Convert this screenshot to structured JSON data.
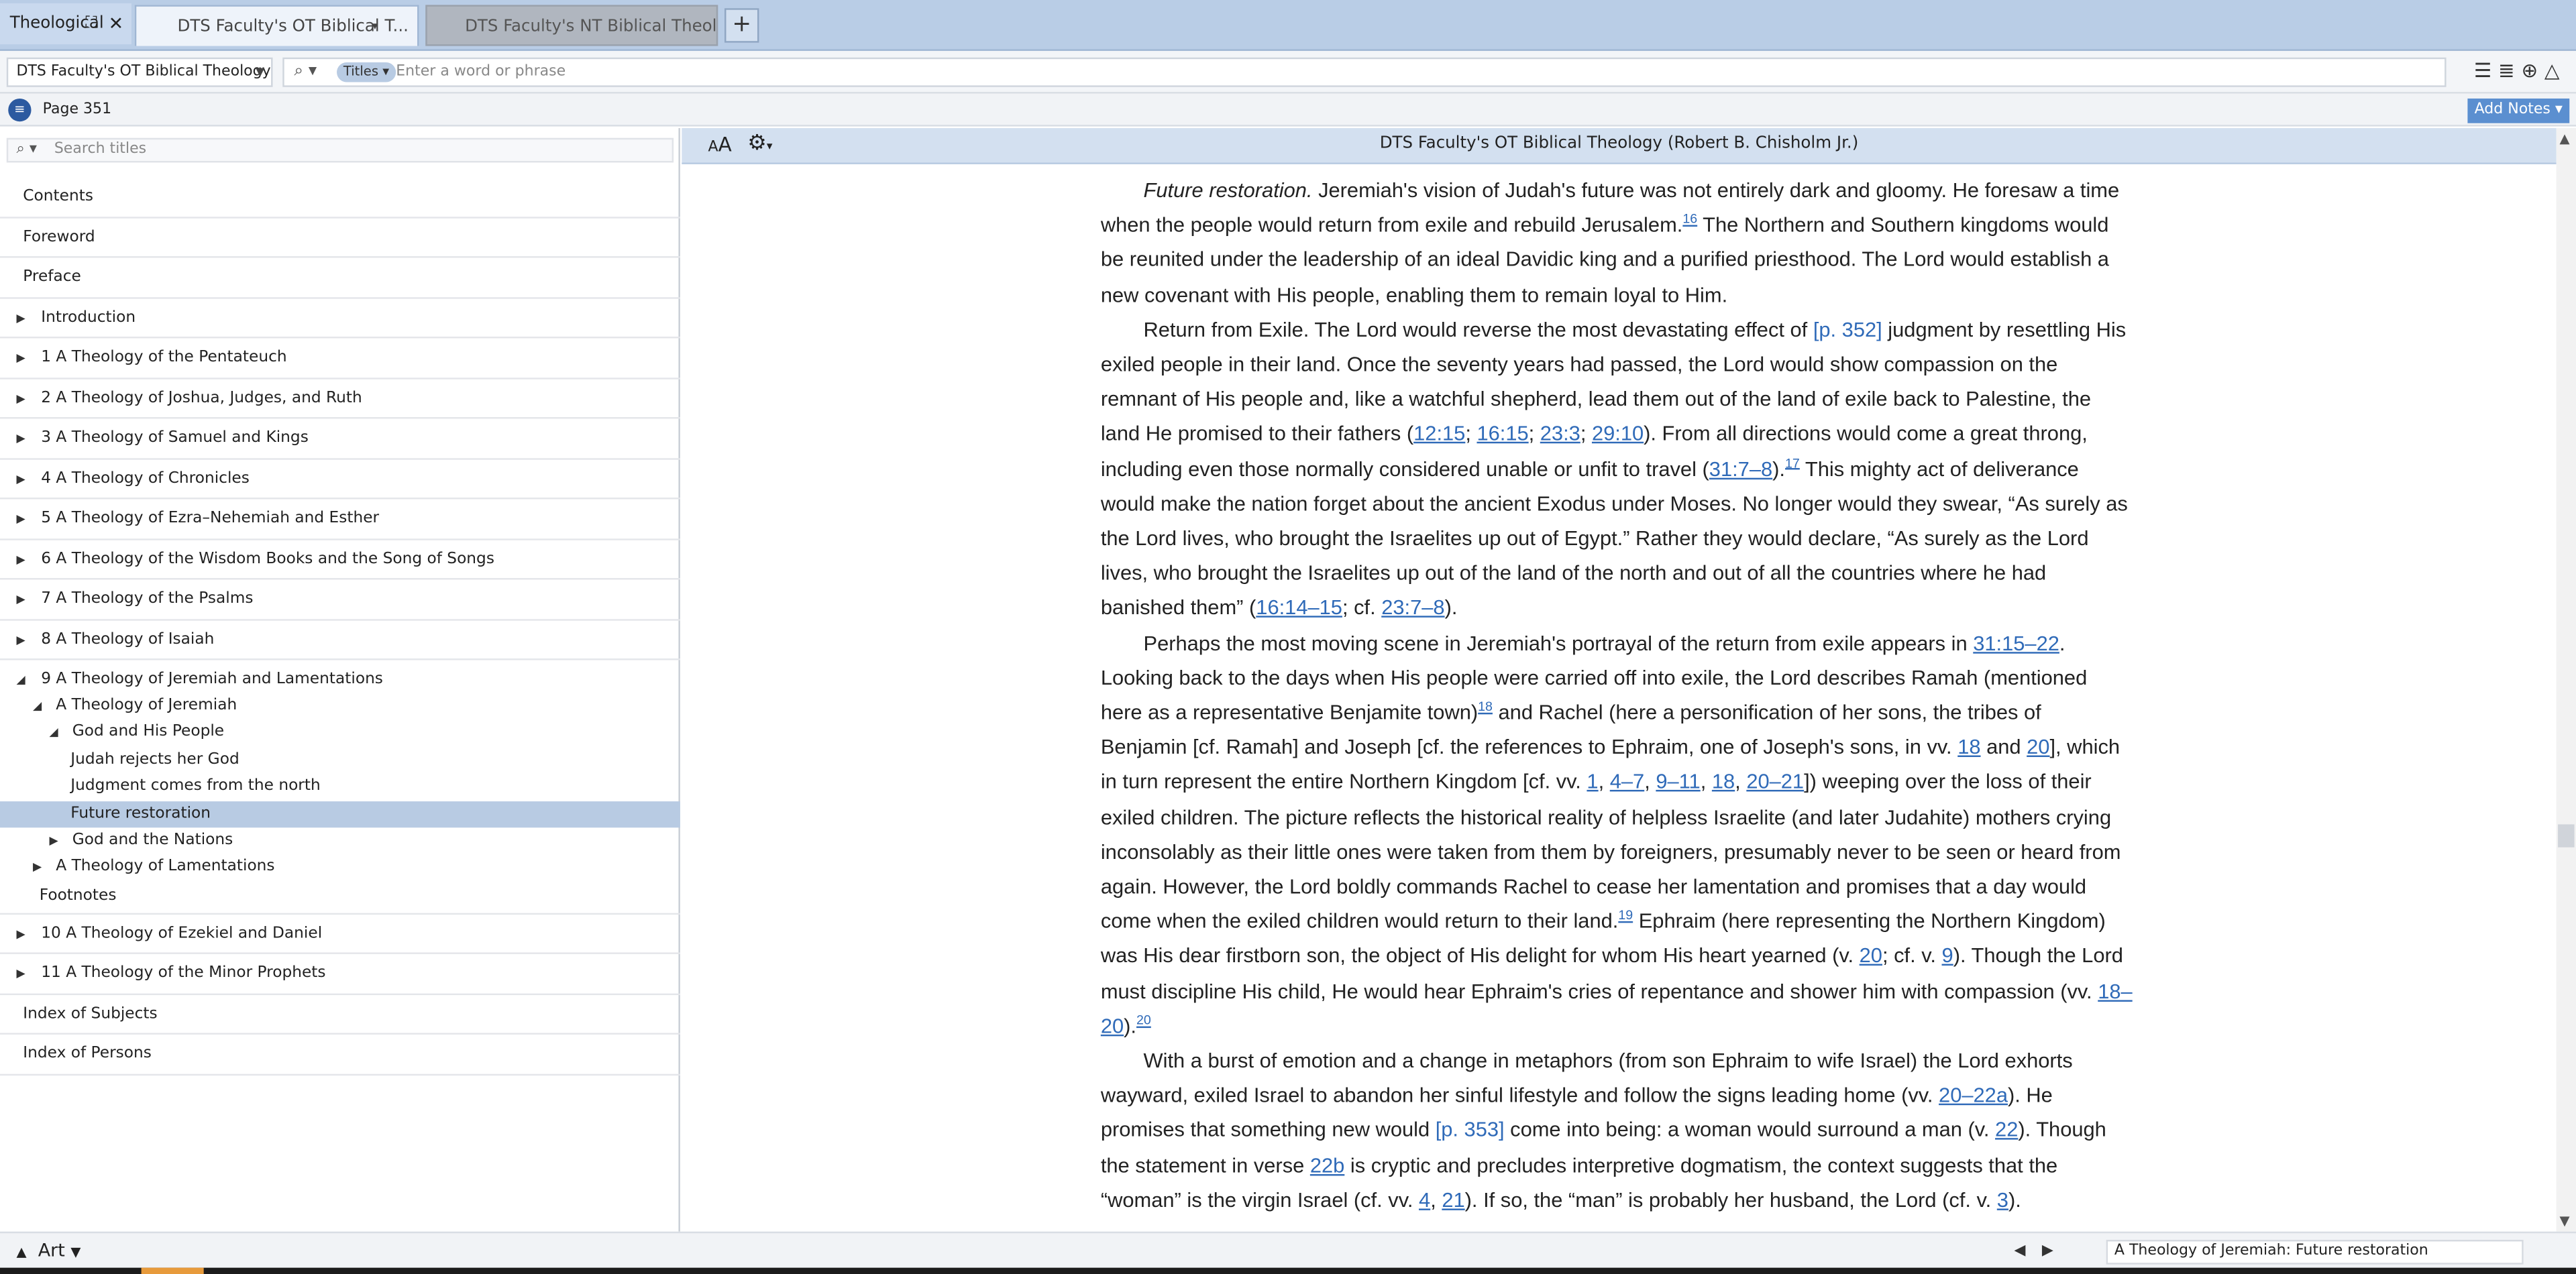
{
  "tabs": {
    "group_label": "Theological",
    "group_expand_icon": "expand-icon",
    "group_close_icon": "close-icon",
    "active_label": "DTS Faculty's OT Biblical T...",
    "inactive_label": "DTS Faculty's NT Biblical Theology",
    "new_tab": "+"
  },
  "toolbar": {
    "book_select": "DTS Faculty's OT Biblical Theology",
    "search_scope": "Titles",
    "search_placeholder": "Enter a word or phrase"
  },
  "pagebar": {
    "page_label": "Page 351",
    "add_notes": "Add Notes"
  },
  "sidebar": {
    "search_placeholder": "Search titles",
    "toc": [
      {
        "label": "Contents",
        "indent": 0,
        "arrow": "none"
      },
      {
        "label": "Foreword",
        "indent": 0,
        "arrow": "none"
      },
      {
        "label": "Preface",
        "indent": 0,
        "arrow": "none"
      },
      {
        "label": "Introduction",
        "indent": 0,
        "arrow": "right"
      },
      {
        "label": "1 A Theology of the Pentateuch",
        "indent": 0,
        "arrow": "right"
      },
      {
        "label": "2 A Theology of Joshua, Judges, and Ruth",
        "indent": 0,
        "arrow": "right"
      },
      {
        "label": "3 A Theology of Samuel and Kings",
        "indent": 0,
        "arrow": "right"
      },
      {
        "label": "4 A Theology of Chronicles",
        "indent": 0,
        "arrow": "right"
      },
      {
        "label": "5 A Theology of Ezra–Nehemiah and Esther",
        "indent": 0,
        "arrow": "right"
      },
      {
        "label": "6 A Theology of the Wisdom Books and the Song of Songs",
        "indent": 0,
        "arrow": "right"
      },
      {
        "label": "7 A Theology of the Psalms",
        "indent": 0,
        "arrow": "right"
      },
      {
        "label": "8 A Theology of Isaiah",
        "indent": 0,
        "arrow": "right"
      },
      {
        "label": "9 A Theology of Jeremiah and Lamentations",
        "indent": 0,
        "arrow": "down",
        "group_top": true
      },
      {
        "label": "A Theology of Jeremiah",
        "indent": 1,
        "arrow": "down"
      },
      {
        "label": "God and His People",
        "indent": 2,
        "arrow": "down"
      },
      {
        "label": "Judah rejects her God",
        "indent": 3,
        "arrow": "none"
      },
      {
        "label": "Judgment comes from the north",
        "indent": 3,
        "arrow": "none"
      },
      {
        "label": "Future restoration",
        "indent": 3,
        "arrow": "none",
        "selected": true
      },
      {
        "label": "God and the Nations",
        "indent": 2,
        "arrow": "right"
      },
      {
        "label": "A Theology of Lamentations",
        "indent": 1,
        "arrow": "right"
      },
      {
        "label": "Footnotes",
        "indent": 1,
        "arrow": "none",
        "group_end": true
      },
      {
        "label": "10 A Theology of Ezekiel and Daniel",
        "indent": 0,
        "arrow": "right"
      },
      {
        "label": "11 A Theology of the Minor Prophets",
        "indent": 0,
        "arrow": "right"
      },
      {
        "label": "Index of Subjects",
        "indent": 0,
        "arrow": "none"
      },
      {
        "label": "Index of Persons",
        "indent": 0,
        "arrow": "none"
      }
    ]
  },
  "content": {
    "book_title": "DTS Faculty's OT Biblical Theology (Robert B. Chisholm Jr.)",
    "font_size_icon": "AA",
    "paragraphs": [
      [
        {
          "t": "Future restoration.",
          "s": "i"
        },
        {
          "t": " Jeremiah's vision of Judah's future was not entirely dark and gloomy. He foresaw a time when the people would return from exile and rebuild Jerusalem."
        },
        {
          "t": "16",
          "s": "fn"
        },
        {
          "t": " The Northern and Southern kingdoms would be reunited under the leadership of an ideal Davidic king and a purified priesthood. The Lord would establish a new covenant with His people, enabling them to remain loyal to Him."
        }
      ],
      [
        {
          "t": "Return from Exile. The Lord would reverse the most devastating effect of "
        },
        {
          "t": "[p. 352]",
          "s": "pg"
        },
        {
          "t": " judgment by resettling His exiled people in their land. Once the seventy years had passed, the Lord would show compassion on the remnant of His people and, like a watchful shepherd, lead them out of the land of exile back to Palestine, the land He promised to their fathers ("
        },
        {
          "t": "12:15",
          "s": "ref"
        },
        {
          "t": "; "
        },
        {
          "t": "16:15",
          "s": "ref"
        },
        {
          "t": "; "
        },
        {
          "t": "23:3",
          "s": "ref"
        },
        {
          "t": "; "
        },
        {
          "t": "29:10",
          "s": "ref"
        },
        {
          "t": "). From all directions would come a great throng, including even those normally considered unable or unfit to travel ("
        },
        {
          "t": "31:7–8",
          "s": "ref"
        },
        {
          "t": ")."
        },
        {
          "t": "17",
          "s": "fn"
        },
        {
          "t": " This mighty act of deliverance would make the nation forget about the ancient Exodus under Moses. No longer would they swear, “As surely as the Lord lives, who brought the Israelites up out of Egypt.” Rather they would declare, “As surely as the Lord lives, who brought the Israelites up out of the land of the north and out of all the countries where he had banished them” ("
        },
        {
          "t": "16:14–15",
          "s": "ref"
        },
        {
          "t": "; cf. "
        },
        {
          "t": "23:7–8",
          "s": "ref"
        },
        {
          "t": ")."
        }
      ],
      [
        {
          "t": "Perhaps the most moving scene in Jeremiah's portrayal of the return from exile appears in "
        },
        {
          "t": "31:15–22",
          "s": "ref"
        },
        {
          "t": ". Looking back to the days when His people were carried off into exile, the Lord describes Ramah (mentioned here as a representative Benjamite town)"
        },
        {
          "t": "18",
          "s": "fn"
        },
        {
          "t": " and Rachel (here a personification of her sons, the tribes of Benjamin [cf. Ramah] and Joseph [cf. the references to Ephraim, one of Joseph's sons, in vv. "
        },
        {
          "t": "18",
          "s": "ref"
        },
        {
          "t": " and "
        },
        {
          "t": "20",
          "s": "ref"
        },
        {
          "t": "], which in turn represent the entire Northern Kingdom [cf. vv. "
        },
        {
          "t": "1",
          "s": "ref"
        },
        {
          "t": ", "
        },
        {
          "t": "4–7",
          "s": "ref"
        },
        {
          "t": ", "
        },
        {
          "t": "9–11",
          "s": "ref"
        },
        {
          "t": ", "
        },
        {
          "t": "18",
          "s": "ref"
        },
        {
          "t": ", "
        },
        {
          "t": "20–21",
          "s": "ref"
        },
        {
          "t": "]) weeping over the loss of their exiled children. The picture reflects the historical reality of helpless Israelite (and later Judahite) mothers crying inconsolably as their little ones were taken from them by foreigners, presumably never to be seen or heard from again. However, the Lord boldly commands Rachel to cease her lamentation and promises that a day would come when the exiled children would return to their land."
        },
        {
          "t": "19",
          "s": "fn"
        },
        {
          "t": " Ephraim (here representing the Northern Kingdom) was His dear firstborn son, the object of His delight for whom His heart yearned (v. "
        },
        {
          "t": "20",
          "s": "ref"
        },
        {
          "t": "; cf. v. "
        },
        {
          "t": "9",
          "s": "ref"
        },
        {
          "t": "). Though the Lord must discipline His child, He would hear Ephraim's cries of repentance and shower him with compassion (vv. "
        },
        {
          "t": "18–20",
          "s": "ref"
        },
        {
          "t": ")."
        },
        {
          "t": "20",
          "s": "fn"
        }
      ],
      [
        {
          "t": "With a burst of emotion and a change in metaphors (from son Ephraim to wife Israel) the Lord exhorts wayward, exiled Israel to abandon her sinful lifestyle and follow the signs leading home (vv. "
        },
        {
          "t": "20–22a",
          "s": "ref"
        },
        {
          "t": "). He promises that something new would "
        },
        {
          "t": "[p. 353]",
          "s": "pg"
        },
        {
          "t": " come into being: a woman would surround a man (v. "
        },
        {
          "t": "22",
          "s": "ref"
        },
        {
          "t": "). Though the statement in verse "
        },
        {
          "t": "22b",
          "s": "ref"
        },
        {
          "t": " is cryptic and precludes interpretive dogmatism, the context suggests that the “woman” is the virgin Israel (cf. vv. "
        },
        {
          "t": "4",
          "s": "ref"
        },
        {
          "t": ", "
        },
        {
          "t": "21",
          "s": "ref"
        },
        {
          "t": "). If so, the “man” is probably her husband, the Lord (cf. v. "
        },
        {
          "t": "3",
          "s": "ref"
        },
        {
          "t": ")."
        }
      ]
    ]
  },
  "statusbar": {
    "art_label": "Art",
    "current_section": "A Theology of Jeremiah: Future restoration"
  },
  "colors": {
    "tabbar": "#b9cde6",
    "accent": "#5b8fd0",
    "link": "#2f6ab8",
    "selected": "#b8cbe3"
  }
}
